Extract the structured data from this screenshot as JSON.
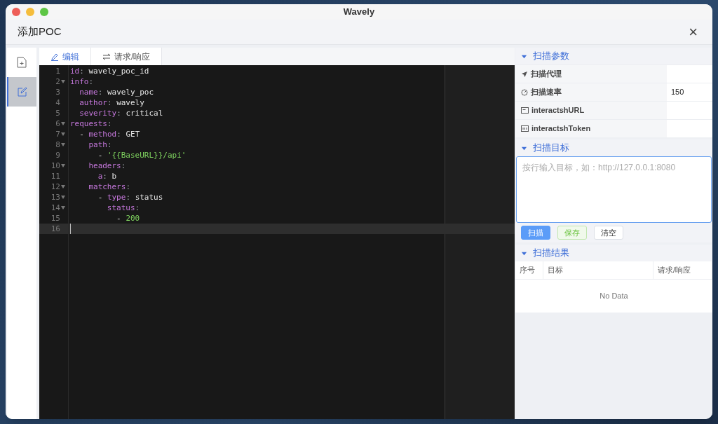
{
  "window": {
    "title": "Wavely"
  },
  "dialog": {
    "title": "添加POC",
    "close": "×"
  },
  "sidebar": {
    "items": [
      {
        "kind": "new-file",
        "selected": false
      },
      {
        "kind": "edit",
        "selected": true
      }
    ]
  },
  "editor_tabs": [
    {
      "label": "编辑",
      "kind": "edit",
      "selected": true
    },
    {
      "label": "请求/响应",
      "kind": "swap",
      "selected": false
    }
  ],
  "code": {
    "lines": [
      {
        "number": "1",
        "fold": false,
        "active": false,
        "tokens": [
          {
            "kind": "key",
            "text": "id"
          },
          {
            "kind": "punct",
            "text": ": "
          },
          {
            "kind": "plain",
            "text": "wavely_poc_id"
          }
        ]
      },
      {
        "number": "2",
        "fold": true,
        "active": false,
        "tokens": [
          {
            "kind": "key",
            "text": "info"
          },
          {
            "kind": "punct",
            "text": ":"
          }
        ]
      },
      {
        "number": "3",
        "fold": false,
        "active": false,
        "tokens": [
          {
            "kind": "key",
            "text": "  name"
          },
          {
            "kind": "punct",
            "text": ": "
          },
          {
            "kind": "plain",
            "text": "wavely_poc"
          }
        ]
      },
      {
        "number": "4",
        "fold": false,
        "active": false,
        "tokens": [
          {
            "kind": "key",
            "text": "  author"
          },
          {
            "kind": "punct",
            "text": ": "
          },
          {
            "kind": "plain",
            "text": "wavely"
          }
        ]
      },
      {
        "number": "5",
        "fold": false,
        "active": false,
        "tokens": [
          {
            "kind": "key",
            "text": "  severity"
          },
          {
            "kind": "punct",
            "text": ": "
          },
          {
            "kind": "plain",
            "text": "critical"
          }
        ]
      },
      {
        "number": "6",
        "fold": true,
        "active": false,
        "tokens": [
          {
            "kind": "key",
            "text": "requests"
          },
          {
            "kind": "punct",
            "text": ":"
          }
        ]
      },
      {
        "number": "7",
        "fold": true,
        "active": false,
        "tokens": [
          {
            "kind": "plain",
            "text": "  - "
          },
          {
            "kind": "key",
            "text": "method"
          },
          {
            "kind": "punct",
            "text": ": "
          },
          {
            "kind": "plain",
            "text": "GET"
          }
        ]
      },
      {
        "number": "8",
        "fold": true,
        "active": false,
        "tokens": [
          {
            "kind": "key",
            "text": "    path"
          },
          {
            "kind": "punct",
            "text": ":"
          }
        ]
      },
      {
        "number": "9",
        "fold": false,
        "active": false,
        "tokens": [
          {
            "kind": "plain",
            "text": "      - "
          },
          {
            "kind": "string",
            "text": "'{{BaseURL}}/api'"
          }
        ]
      },
      {
        "number": "10",
        "fold": true,
        "active": false,
        "tokens": [
          {
            "kind": "key",
            "text": "    headers"
          },
          {
            "kind": "punct",
            "text": ":"
          }
        ]
      },
      {
        "number": "11",
        "fold": false,
        "active": false,
        "tokens": [
          {
            "kind": "key",
            "text": "      a"
          },
          {
            "kind": "punct",
            "text": ": "
          },
          {
            "kind": "plain",
            "text": "b"
          }
        ]
      },
      {
        "number": "12",
        "fold": true,
        "active": false,
        "tokens": [
          {
            "kind": "key",
            "text": "    matchers"
          },
          {
            "kind": "punct",
            "text": ":"
          }
        ]
      },
      {
        "number": "13",
        "fold": true,
        "active": false,
        "tokens": [
          {
            "kind": "plain",
            "text": "      - "
          },
          {
            "kind": "key",
            "text": "type"
          },
          {
            "kind": "punct",
            "text": ": "
          },
          {
            "kind": "plain",
            "text": "status"
          }
        ]
      },
      {
        "number": "14",
        "fold": true,
        "active": false,
        "tokens": [
          {
            "kind": "key",
            "text": "        status"
          },
          {
            "kind": "punct",
            "text": ":"
          }
        ]
      },
      {
        "number": "15",
        "fold": false,
        "active": false,
        "tokens": [
          {
            "kind": "plain",
            "text": "          - "
          },
          {
            "kind": "number",
            "text": "200"
          }
        ]
      },
      {
        "number": "16",
        "fold": false,
        "active": true
      }
    ]
  },
  "scan_params": {
    "title": "扫描参数",
    "expanded": true,
    "rows": [
      {
        "kind": "proxy",
        "label": "扫描代理"
      },
      {
        "kind": "rate",
        "label": "扫描速率",
        "value": "150"
      },
      {
        "kind": "url",
        "label": "interactshURL"
      },
      {
        "kind": "token",
        "label": "interactshToken"
      }
    ]
  },
  "scan_target": {
    "title": "扫描目标",
    "expanded": true,
    "placeholder": "按行输入目标，如：http://127.0.0.1:8080",
    "buttons": [
      {
        "label": "扫描",
        "kind": "primary"
      },
      {
        "label": "保存",
        "kind": "success"
      },
      {
        "label": "清空",
        "kind": "default"
      }
    ]
  },
  "scan_results": {
    "title": "扫描结果",
    "expanded": true,
    "columns": [
      "序号",
      "目标",
      "请求/响应"
    ],
    "empty_text": "No Data"
  }
}
